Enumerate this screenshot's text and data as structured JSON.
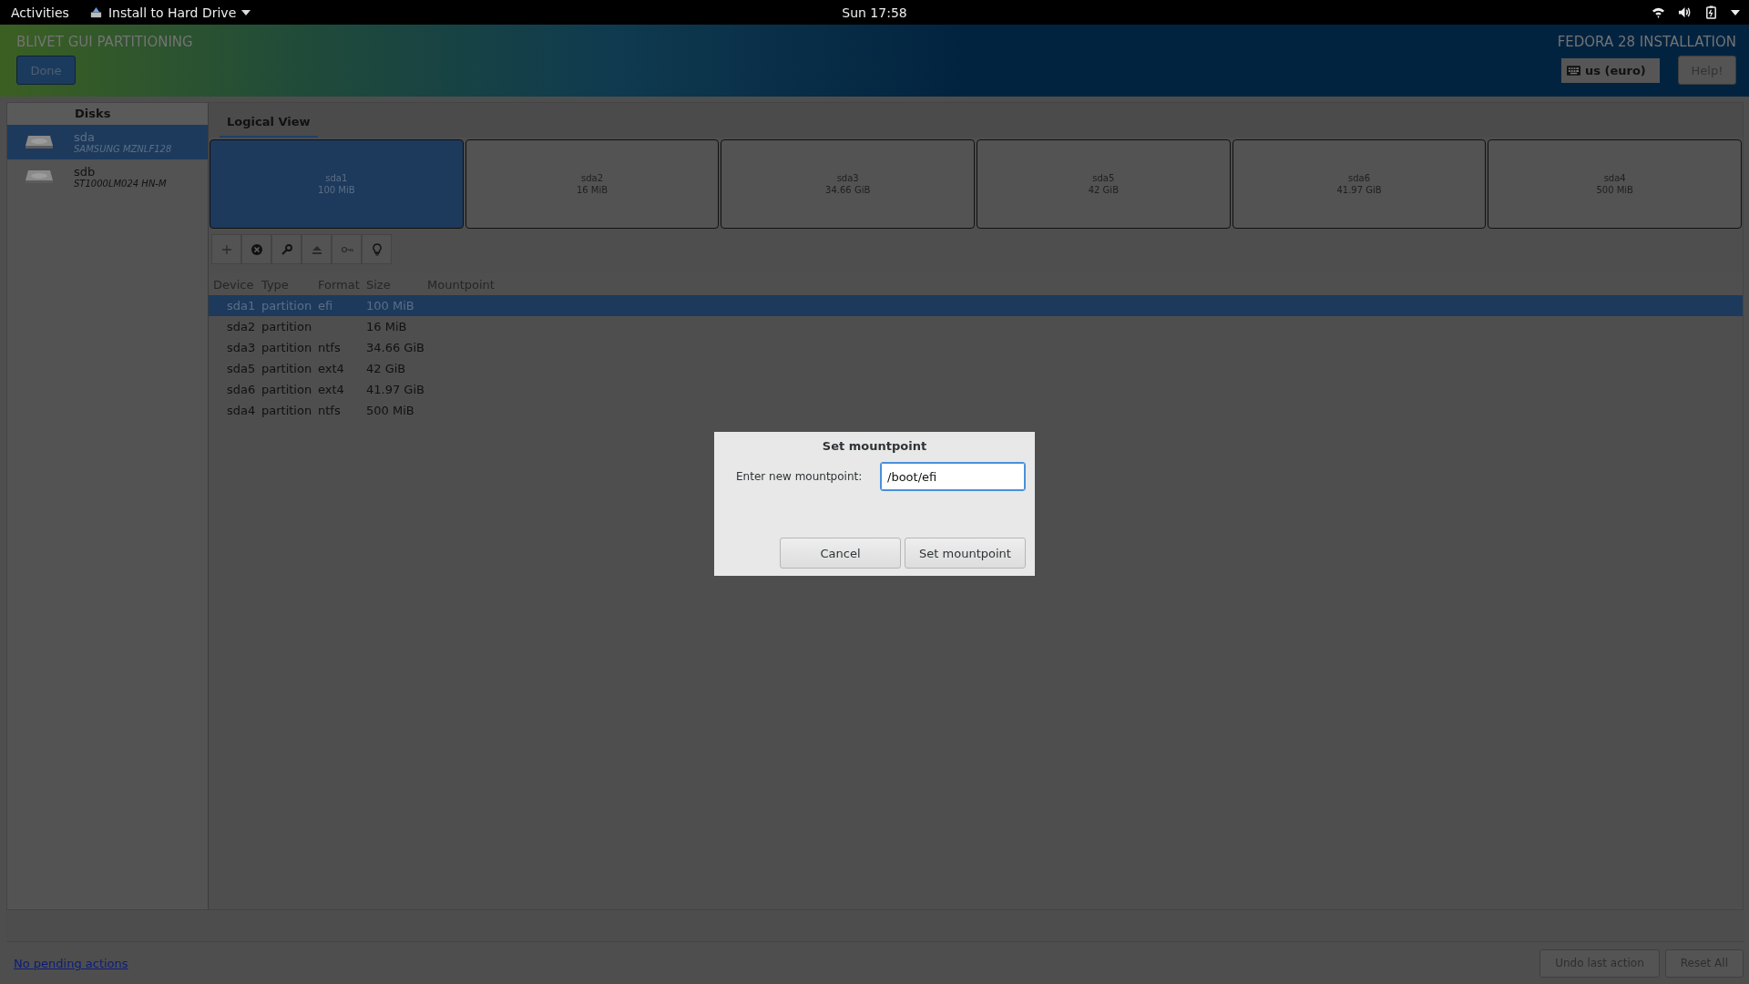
{
  "top_bar": {
    "activities": "Activities",
    "app_menu": "Install to Hard Drive",
    "clock": "Sun 17:58"
  },
  "header": {
    "title": "BLIVET GUI PARTITIONING",
    "done_button": "Done",
    "product": "FEDORA 28 INSTALLATION",
    "keyboard_layout": "us (euro)",
    "help_button": "Help!"
  },
  "sidebar": {
    "heading": "Disks",
    "items": [
      {
        "name": "sda",
        "model": "SAMSUNG MZNLF128",
        "selected": true
      },
      {
        "name": "sdb",
        "model": "ST1000LM024 HN-M",
        "selected": false
      }
    ]
  },
  "tabs": [
    {
      "label": "Logical View",
      "selected": true
    }
  ],
  "partitions": [
    {
      "name": "sda1",
      "size": "100 MiB",
      "selected": true
    },
    {
      "name": "sda2",
      "size": "16 MiB",
      "selected": false
    },
    {
      "name": "sda3",
      "size": "34.66 GiB",
      "selected": false
    },
    {
      "name": "sda5",
      "size": "42 GiB",
      "selected": false
    },
    {
      "name": "sda6",
      "size": "41.97 GiB",
      "selected": false
    },
    {
      "name": "sda4",
      "size": "500 MiB",
      "selected": false
    }
  ],
  "toolbar": [
    {
      "kind": "add"
    },
    {
      "kind": "remove"
    },
    {
      "kind": "edit"
    },
    {
      "kind": "unmount"
    },
    {
      "kind": "decrypt"
    },
    {
      "kind": "info"
    }
  ],
  "table": {
    "columns": [
      "Device",
      "Type",
      "Format",
      "Size",
      "Mountpoint"
    ],
    "rows": [
      {
        "cells": [
          "sda1",
          "partition",
          "efi",
          "100 MiB"
        ],
        "selected": true
      },
      {
        "cells": [
          "sda2",
          "partition",
          "",
          "16 MiB"
        ],
        "selected": false
      },
      {
        "cells": [
          "sda3",
          "partition",
          "ntfs",
          "34.66 GiB"
        ],
        "selected": false
      },
      {
        "cells": [
          "sda5",
          "partition",
          "ext4",
          "42 GiB"
        ],
        "selected": false
      },
      {
        "cells": [
          "sda6",
          "partition",
          "ext4",
          "41.97 GiB"
        ],
        "selected": false
      },
      {
        "cells": [
          "sda4",
          "partition",
          "ntfs",
          "500 MiB"
        ],
        "selected": false
      }
    ]
  },
  "dialog": {
    "title": "Set mountpoint",
    "label": "Enter new mountpoint:",
    "value": "/boot/efi",
    "buttons": [
      "Cancel",
      "Set mountpoint"
    ]
  },
  "footer": {
    "status_link": "No pending actions",
    "buttons": [
      "Undo last action",
      "Reset All"
    ]
  }
}
